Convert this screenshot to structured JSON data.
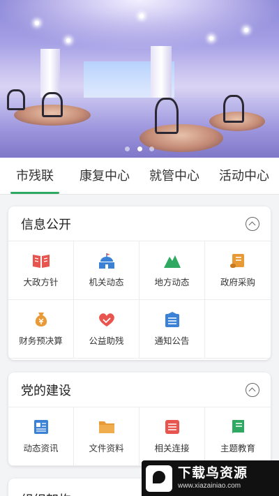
{
  "banner": {
    "slide_count": 3,
    "active_slide": 1
  },
  "tabs": [
    {
      "label": "市残联",
      "active": true
    },
    {
      "label": "康复中心",
      "active": false
    },
    {
      "label": "就管中心",
      "active": false
    },
    {
      "label": "活动中心",
      "active": false
    }
  ],
  "sections": [
    {
      "title": "信息公开",
      "items": [
        {
          "label": "大政方针",
          "icon": "book-icon",
          "color": "#e8554e"
        },
        {
          "label": "机关动态",
          "icon": "building-icon",
          "color": "#3b82d6"
        },
        {
          "label": "地方动态",
          "icon": "mountain-icon",
          "color": "#2fa861"
        },
        {
          "label": "政府采购",
          "icon": "scroll-icon",
          "color": "#e89a36"
        },
        {
          "label": "财务预决算",
          "icon": "money-bag-icon",
          "color": "#e89a36"
        },
        {
          "label": "公益助残",
          "icon": "heart-hand-icon",
          "color": "#e8554e"
        },
        {
          "label": "通知公告",
          "icon": "notice-icon",
          "color": "#3b82d6"
        }
      ]
    },
    {
      "title": "党的建设",
      "items": [
        {
          "label": "动态资讯",
          "icon": "news-icon",
          "color": "#3b82d6"
        },
        {
          "label": "文件资料",
          "icon": "folder-icon",
          "color": "#e89a36"
        },
        {
          "label": "相关连接",
          "icon": "link-list-icon",
          "color": "#e8554e"
        },
        {
          "label": "主题教育",
          "icon": "textbook-icon",
          "color": "#2fa861"
        }
      ]
    },
    {
      "title": "组织架构"
    }
  ],
  "watermark": {
    "text": "下载鸟资源",
    "url": "www.xiazainiao.com"
  }
}
